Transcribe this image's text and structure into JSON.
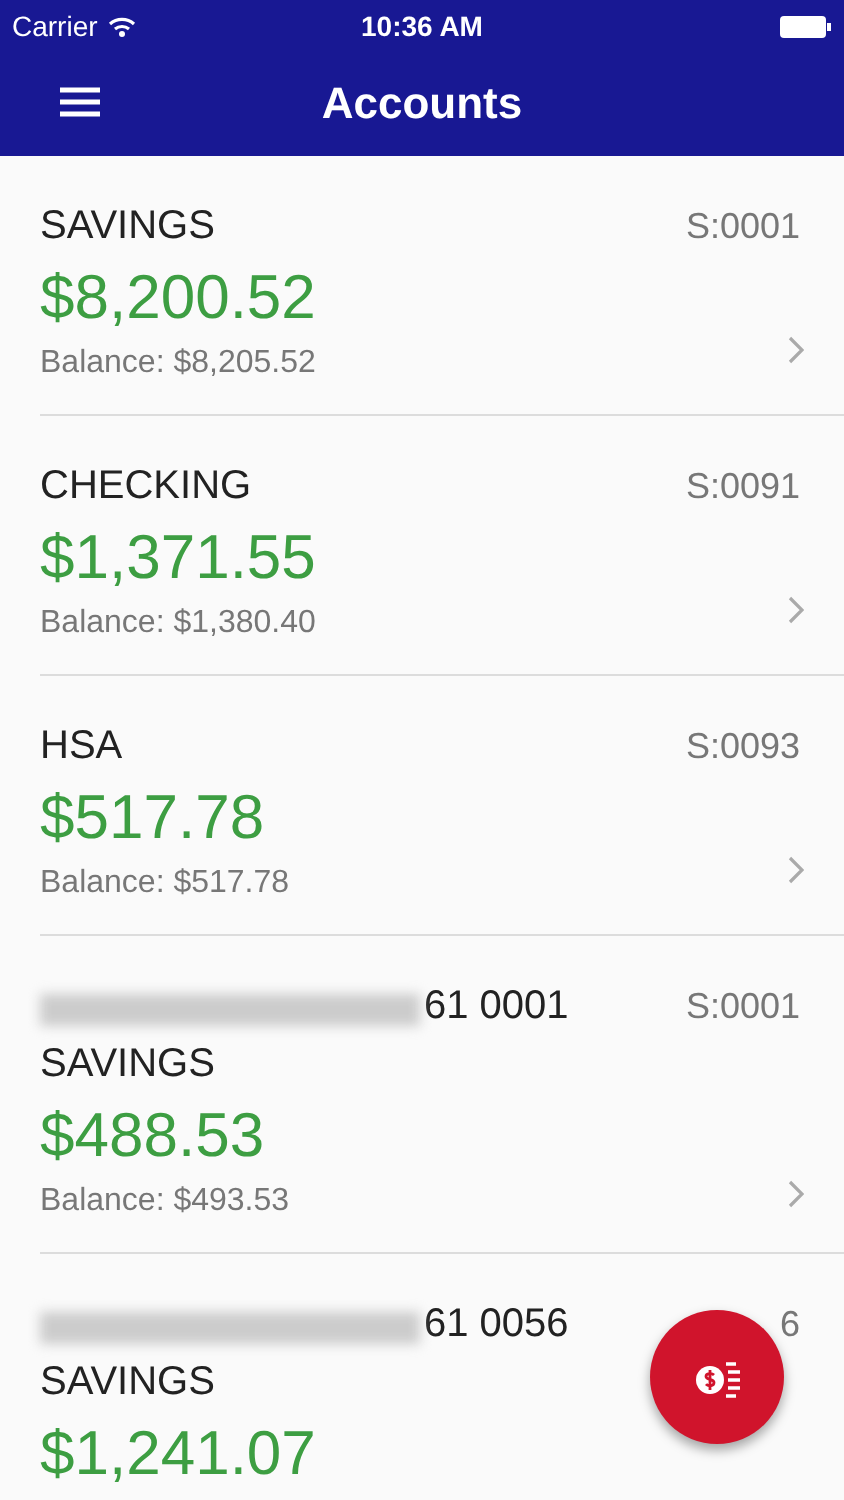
{
  "status_bar": {
    "carrier": "Carrier",
    "time": "10:36 AM"
  },
  "nav": {
    "title": "Accounts"
  },
  "accounts": [
    {
      "kind": "own",
      "name": "SAVINGS",
      "id": "S:0001",
      "available": "$8,200.52",
      "balance": "Balance: $8,205.52"
    },
    {
      "kind": "own",
      "name": "CHECKING",
      "id": "S:0091",
      "available": "$1,371.55",
      "balance": "Balance: $1,380.40"
    },
    {
      "kind": "own",
      "name": "HSA",
      "id": "S:0093",
      "available": "$517.78",
      "balance": "Balance: $517.78"
    },
    {
      "kind": "joint",
      "holder_number": "61 0001",
      "name": "SAVINGS",
      "id": "S:0001",
      "available": "$488.53",
      "balance": "Balance: $493.53"
    },
    {
      "kind": "joint",
      "holder_number": "61 0056",
      "name": "SAVINGS",
      "id": "6",
      "available": "$1,241.07"
    }
  ]
}
